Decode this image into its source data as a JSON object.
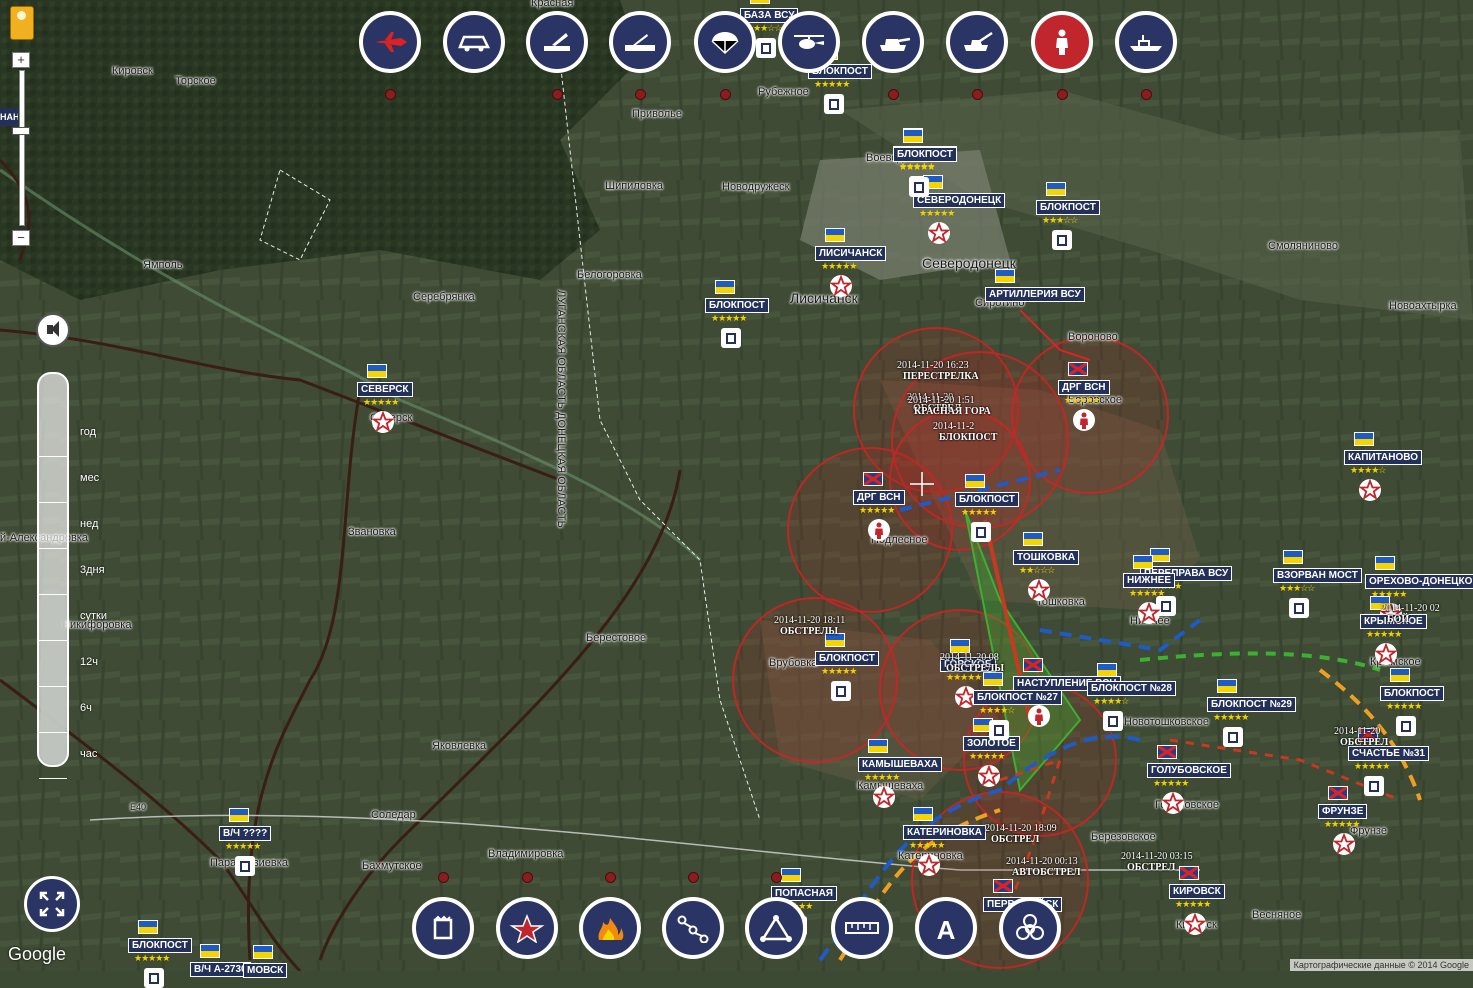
{
  "top_toolbar": [
    {
      "name": "aircraft",
      "dot": true
    },
    {
      "name": "apc",
      "dot": false
    },
    {
      "name": "rocket-launcher",
      "dot": true
    },
    {
      "name": "sam-system",
      "dot": true
    },
    {
      "name": "paratrooper",
      "dot": true
    },
    {
      "name": "helicopter",
      "dot": false
    },
    {
      "name": "tank",
      "dot": true
    },
    {
      "name": "artillery",
      "dot": true
    },
    {
      "name": "infantry",
      "dot": true,
      "active": true
    },
    {
      "name": "warship",
      "dot": true
    }
  ],
  "bottom_toolbar": [
    {
      "name": "checkpoint",
      "dot": true
    },
    {
      "name": "star",
      "dot": true
    },
    {
      "name": "fire",
      "dot": true
    },
    {
      "name": "route",
      "dot": true
    },
    {
      "name": "triangle",
      "dot": true
    },
    {
      "name": "ruler",
      "dot": false
    },
    {
      "name": "text-a",
      "dot": false
    },
    {
      "name": "biohazard",
      "dot": false
    }
  ],
  "time_slider": {
    "labels": [
      "год",
      "мес",
      "нед",
      "3дня",
      "сутки",
      "12ч",
      "6ч",
      "час"
    ]
  },
  "places": [
    {
      "text": "Кировск",
      "cls": ""
    },
    {
      "text": "Торское",
      "cls": ""
    },
    {
      "text": "Приволье",
      "cls": ""
    },
    {
      "text": "Шипиловка",
      "cls": ""
    },
    {
      "text": "Новодружеск",
      "cls": ""
    },
    {
      "text": "Воеводовка",
      "cls": ""
    },
    {
      "text": "Лисичанск",
      "cls": "big"
    },
    {
      "text": "Северодонецк",
      "cls": "big"
    },
    {
      "text": "Смоляниново",
      "cls": ""
    },
    {
      "text": "Ямполь",
      "cls": ""
    },
    {
      "text": "Серебрянка",
      "cls": ""
    },
    {
      "text": "Белогоровка",
      "cls": ""
    },
    {
      "text": "Сиротино",
      "cls": ""
    },
    {
      "text": "Вороново",
      "cls": ""
    },
    {
      "text": "Боровское",
      "cls": ""
    },
    {
      "text": "Новоахтырка",
      "cls": ""
    },
    {
      "text": "Северск",
      "cls": ""
    },
    {
      "text": "Звановка",
      "cls": ""
    },
    {
      "text": "Подлесное",
      "cls": ""
    },
    {
      "text": "Тошковка",
      "cls": ""
    },
    {
      "text": "Нижнее",
      "cls": ""
    },
    {
      "text": "Берестовое",
      "cls": ""
    },
    {
      "text": "Врубовка",
      "cls": ""
    },
    {
      "text": "Крымское",
      "cls": ""
    },
    {
      "text": "Яковлевка",
      "cls": ""
    },
    {
      "text": "Новотошковское",
      "cls": ""
    },
    {
      "text": "Голубовское",
      "cls": ""
    },
    {
      "text": "Фрунзе",
      "cls": ""
    },
    {
      "text": "Камышеваха",
      "cls": ""
    },
    {
      "text": "Соледар",
      "cls": ""
    },
    {
      "text": "Березовское",
      "cls": ""
    },
    {
      "text": "Бахмутское",
      "cls": ""
    },
    {
      "text": "Владимировка",
      "cls": ""
    },
    {
      "text": "Катериновка",
      "cls": ""
    },
    {
      "text": "Весняное",
      "cls": ""
    },
    {
      "text": "Кировск",
      "cls": ""
    },
    {
      "text": "Парасковиевка",
      "cls": ""
    },
    {
      "text": "Никифоровка",
      "cls": ""
    },
    {
      "text": "й-Александровка",
      "cls": ""
    },
    {
      "text": "E40",
      "cls": ""
    },
    {
      "text": "Рубежное",
      "cls": ""
    },
    {
      "text": "Красная",
      "cls": ""
    }
  ],
  "region_label": "ЛУГАНСКАЯ ОБЛАСТЬ ДОНЕЦКАЯ ОБЛАСТЬ",
  "markers": [
    {
      "label": "БАЗА ВСУ",
      "flag": "ua",
      "icon": "box",
      "stars": "★★★☆☆"
    },
    {
      "label": "БЛОКПОСТ",
      "flag": "ua",
      "icon": "box",
      "stars": "★★★★★"
    },
    {
      "label": "БЛОКПОСТ",
      "flag": "ua",
      "icon": "box",
      "stars": "★★★★★"
    },
    {
      "label": "СЕВЕРОДОНЕЦК",
      "flag": "ua",
      "icon": "star",
      "stars": "★★★★★"
    },
    {
      "label": "БЛОКПОСТ",
      "flag": "ua",
      "icon": "box",
      "stars": "★★★☆☆"
    },
    {
      "label": "ЛИСИЧАНСК",
      "flag": "ua",
      "icon": "star",
      "stars": "★★★★★"
    },
    {
      "label": "БЛОКПОСТ",
      "flag": "ua",
      "icon": "box",
      "stars": "★★★★★"
    },
    {
      "label": "АРТИЛЛЕРИЯ ВСУ",
      "flag": "ua",
      "icon": "none",
      "stars": ""
    },
    {
      "label": "СЕВЕРСК",
      "flag": "ua",
      "icon": "star",
      "stars": "★★★★★"
    },
    {
      "label": "ДРГ ВСН",
      "flag": "nr",
      "icon": "inf",
      "stars": "★★★★★"
    },
    {
      "label": "БЛОКПОСТ",
      "flag": "ua",
      "icon": "box",
      "stars": "★★★★★"
    },
    {
      "label": "КАПИТАНОВО",
      "flag": "ua",
      "icon": "star",
      "stars": "★★★★☆"
    },
    {
      "label": "ДРГ ВСН",
      "flag": "nr",
      "icon": "inf",
      "stars": "★★★★★"
    },
    {
      "label": "БЛОКПОСТ",
      "flag": "ua",
      "icon": "box",
      "stars": "★★★★★"
    },
    {
      "label": "ТОШКОВКА",
      "flag": "ua",
      "icon": "star",
      "stars": "★★☆☆☆"
    },
    {
      "label": "ПЕРЕПРАВА ВСУ",
      "flag": "ua",
      "icon": "box",
      "stars": "★★★★★"
    },
    {
      "label": "НИЖНЕЕ",
      "flag": "ua",
      "icon": "star",
      "stars": "★★★★★"
    },
    {
      "label": "ВЗОРВАН МОСТ",
      "flag": "ua",
      "icon": "box",
      "stars": "★★★☆☆"
    },
    {
      "label": "ОРЕХОВО-ДОНЕЦКОЕ",
      "flag": "ua",
      "icon": "star",
      "stars": "★★★★★"
    },
    {
      "label": "БЛОКПОСТ",
      "flag": "ua",
      "icon": "box",
      "stars": "★★★★★"
    },
    {
      "label": "НАСТУПЛЕНИЕ ВСН",
      "flag": "nr",
      "icon": "inf",
      "stars": "★★★★☆"
    },
    {
      "label": "БЛОКПОСТ №28",
      "flag": "ua",
      "icon": "box",
      "stars": "★★★★☆"
    },
    {
      "label": "БЛОКПОСТ №29",
      "flag": "ua",
      "icon": "box",
      "stars": "★★★★★"
    },
    {
      "label": "БЛОКПОСТ",
      "flag": "ua",
      "icon": "box",
      "stars": "★★★★★"
    },
    {
      "label": "КАМЫШЕВАХА",
      "flag": "ua",
      "icon": "star",
      "stars": "★★★★★"
    },
    {
      "label": "ГОЛУБОВСКОЕ",
      "flag": "nr",
      "icon": "star",
      "stars": "★★★★★"
    },
    {
      "label": "ФРУНЗЕ",
      "flag": "nr",
      "icon": "star",
      "stars": "★★★★★"
    },
    {
      "label": "В/Ч ????",
      "flag": "ua",
      "icon": "box",
      "stars": "★★★★★"
    },
    {
      "label": "КАТЕРИНОВКА",
      "flag": "ua",
      "icon": "star",
      "stars": "★★★★★"
    },
    {
      "label": "ПОПАСНАЯ",
      "flag": "ua",
      "icon": "box",
      "stars": "★★★★★"
    },
    {
      "label": "КИРОВСК",
      "flag": "nr",
      "icon": "star",
      "stars": "★★★★★"
    },
    {
      "label": "БЛОКПОСТ",
      "flag": "ua",
      "icon": "box",
      "stars": "★★★★★"
    },
    {
      "label": "В/Ч А-2730",
      "flag": "ua",
      "icon": "none",
      "stars": ""
    },
    {
      "label": "МОВСК",
      "flag": "ua",
      "icon": "none",
      "stars": ""
    },
    {
      "label": "ПЕРВОМАЙСК",
      "flag": "nr",
      "icon": "none",
      "stars": ""
    },
    {
      "label": "ГОРСКОЕ",
      "flag": "ua",
      "icon": "star",
      "stars": "★★★★★"
    },
    {
      "label": "ЗОЛОТОЕ",
      "flag": "ua",
      "icon": "star",
      "stars": "★★★★★"
    },
    {
      "label": "БЛОКПОСТ №27",
      "flag": "ua",
      "icon": "box",
      "stars": "★★★★☆"
    },
    {
      "label": "КРЫМСКОЕ",
      "flag": "ua",
      "icon": "star",
      "stars": "★★★★★"
    },
    {
      "label": "СЧАСТЬЕ №31",
      "flag": "nr",
      "icon": "box",
      "stars": "★★★★★"
    }
  ],
  "events": [
    {
      "date": "2014-11-20 16:23",
      "text": "ПЕРЕСТРЕЛКА"
    },
    {
      "date": "2014-11-20 ",
      "text": "ОБСТРЕЛ"
    },
    {
      "date": "2014-11-20 18:11",
      "text": "ОБСТРЕЛЫ"
    },
    {
      "date": "2014-11-20 08",
      "text": "ОБСТРЕЛЫ"
    },
    {
      "date": "2014-11-20 18:09",
      "text": "ОБСТРЕЛ"
    },
    {
      "date": "2014-11-20 00:13",
      "text": "АВТОБСТРЕЛ"
    },
    {
      "date": "2014-11-20 03:15",
      "text": "ОБСТРЕЛ"
    },
    {
      "date": "2014-11-20 02",
      "text": "БОЙ"
    },
    {
      "date": "2014-11-20",
      "text": "ОБСТРЕЛ"
    },
    {
      "date": "2014-11-20 1:51",
      "text": "КРАСНАЯ ГОРА"
    },
    {
      "date": "2014-11-2",
      "text": "БЛОКПОСТ"
    }
  ],
  "google_logo": "Google",
  "attribution": "Картографические данные © 2014 Google",
  "side_label": "НАН",
  "colors": {
    "ukraine_blue": "#1e5bc6",
    "ukraine_yellow": "#f5d400",
    "zone_red": "#d22222",
    "marker_navy": "#22305a",
    "front_green": "#3cb030",
    "front_orange": "#f0a020"
  }
}
